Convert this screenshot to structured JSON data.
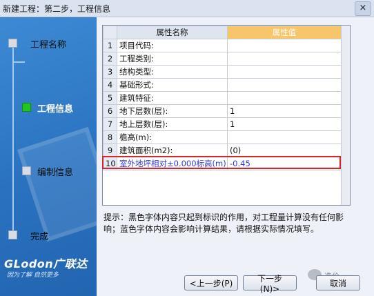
{
  "window": {
    "title": "新建工程：第二步，工程信息",
    "close_glyph": "×"
  },
  "sidebar": {
    "steps": [
      {
        "label": "工程名称",
        "active": false
      },
      {
        "label": "工程信息",
        "active": true
      },
      {
        "label": "编制信息",
        "active": false
      },
      {
        "label": "完成",
        "active": false
      }
    ],
    "logo": "GLodon广联达",
    "slogan": "因为了解 自然更多"
  },
  "grid": {
    "headers": {
      "name": "属性名称",
      "value": "属性值"
    },
    "rows": [
      {
        "num": "1",
        "name": "项目代码:",
        "value": "",
        "color": "black"
      },
      {
        "num": "2",
        "name": "工程类别:",
        "value": "",
        "color": "black"
      },
      {
        "num": "3",
        "name": "结构类型:",
        "value": "",
        "color": "black"
      },
      {
        "num": "4",
        "name": "基础形式:",
        "value": "",
        "color": "black"
      },
      {
        "num": "5",
        "name": "建筑特征:",
        "value": "",
        "color": "black"
      },
      {
        "num": "6",
        "name": "地下层数(层):",
        "value": "1",
        "color": "black"
      },
      {
        "num": "7",
        "name": "地上层数(层):",
        "value": "1",
        "color": "black"
      },
      {
        "num": "8",
        "name": "檐高(m):",
        "value": "",
        "color": "black"
      },
      {
        "num": "9",
        "name": "建筑面积(m2):",
        "value": "(0)",
        "color": "black"
      },
      {
        "num": "10",
        "name": "室外地坪相对±0.000标高(m)",
        "value": "-0.45",
        "color": "blue"
      }
    ]
  },
  "hint": {
    "text": "提示：黑色字体内容只起到标识的作用，对工程量计算没有任何影响；蓝色字体内容会影响计算结果，请根据实际情况填写。"
  },
  "buttons": {
    "prev": "<上一步(P)",
    "next": "下一步(N)>",
    "cancel": "取消"
  },
  "watermark": {
    "text": "造价"
  },
  "colors": {
    "sidebar_blue": "#2a72c0",
    "header_orange": "#f7c56a",
    "active_green": "#23c41f",
    "highlight_red": "#d8252b",
    "blue_text": "#2f3bd1"
  }
}
